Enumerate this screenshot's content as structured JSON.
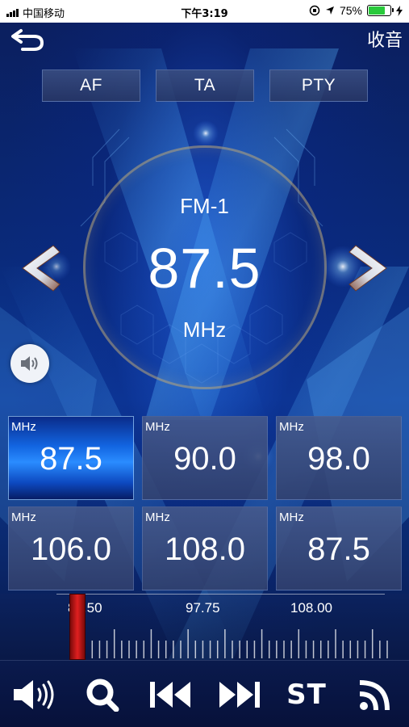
{
  "status_bar": {
    "carrier": "中国移动",
    "time": "下午3:19",
    "battery_percent": "75%",
    "battery_level": 0.75
  },
  "header": {
    "title": "收音"
  },
  "mode_buttons": [
    {
      "label": "AF"
    },
    {
      "label": "TA"
    },
    {
      "label": "PTY"
    }
  ],
  "tuner": {
    "band": "FM-1",
    "frequency": "87.5",
    "unit": "MHz"
  },
  "presets": [
    {
      "unit": "MHz",
      "value": "87.5",
      "active": true
    },
    {
      "unit": "MHz",
      "value": "90.0",
      "active": false
    },
    {
      "unit": "MHz",
      "value": "98.0",
      "active": false
    },
    {
      "unit": "MHz",
      "value": "106.0",
      "active": false
    },
    {
      "unit": "MHz",
      "value": "108.0",
      "active": false
    },
    {
      "unit": "MHz",
      "value": "87.5",
      "active": false
    }
  ],
  "scale": {
    "labels": [
      "87.50",
      "97.75",
      "108.00"
    ],
    "min": 87.5,
    "max": 108.0,
    "current": 87.5
  },
  "bottom_bar": {
    "st_label": "ST",
    "icons": [
      "volume-icon",
      "search-icon",
      "previous-icon",
      "next-icon",
      "stereo-icon",
      "signal-icon"
    ]
  },
  "colors": {
    "accent": "#2a8cff",
    "indicator": "#d01818",
    "battery": "#29c93b"
  }
}
